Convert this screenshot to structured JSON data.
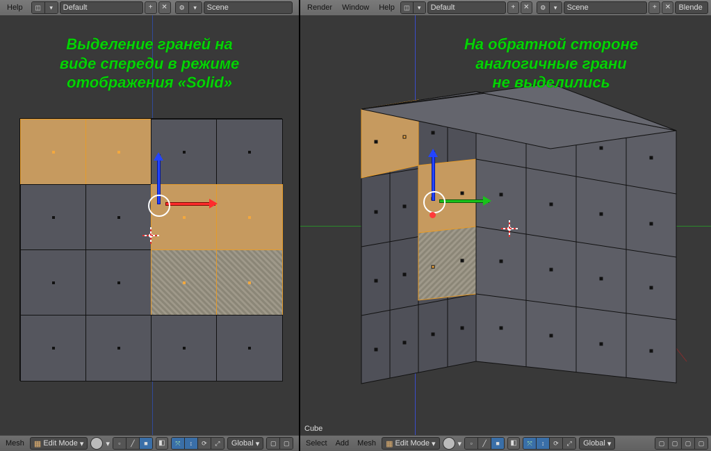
{
  "left": {
    "top_menu": [
      "Help"
    ],
    "layout_field": "Default",
    "scene_field": "Scene",
    "annotation": "Выделение граней на\nвиде спереди в режиме\nотображения «Solid»",
    "footer": {
      "label": "Mesh",
      "mode": "Edit Mode",
      "orient": "Global"
    }
  },
  "right": {
    "top_menu": [
      "Render",
      "Window",
      "Help"
    ],
    "layout_field": "Default",
    "scene_field": "Scene",
    "engine": "Blende",
    "annotation": "На обратной стороне\nаналогичные грани\nне выделились",
    "active_object": "Cube",
    "footer": {
      "label_left": "Select",
      "label_add": "Add",
      "label_mesh": "Mesh",
      "mode": "Edit Mode",
      "orient": "Global"
    }
  }
}
